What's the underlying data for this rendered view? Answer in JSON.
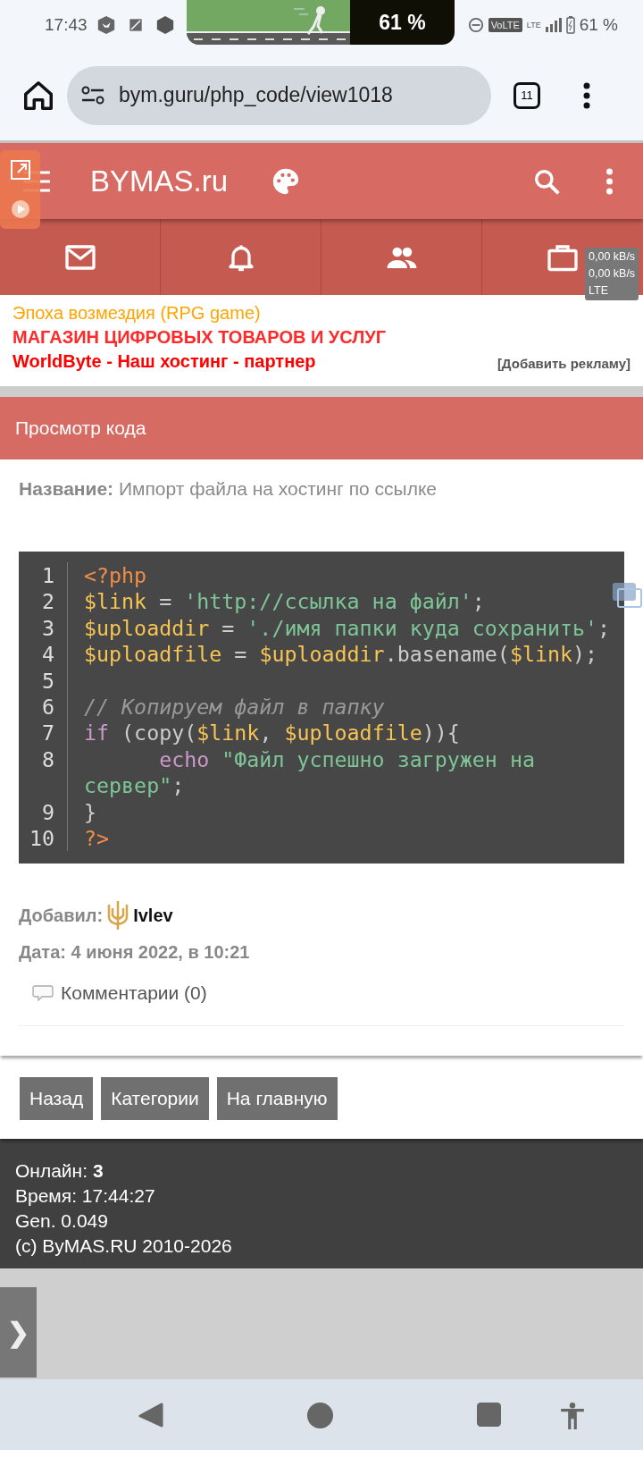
{
  "status_bar": {
    "time": "17:43",
    "media_pill": {
      "kind": "picture",
      "percent": "61 %"
    },
    "volte": "VoLTE",
    "network_type": "LTE",
    "battery": "61 %"
  },
  "browser": {
    "url": "bym.guru/php_code/view1018",
    "tab_count": "11"
  },
  "site_header": {
    "logo": "BYMAS.ru"
  },
  "speed_overlay": {
    "upload": "0,00 kB/s",
    "download": "0,00 kB/s",
    "network": "LTE"
  },
  "ads": [
    {
      "text": "Эпоха возмездия (RPG game)",
      "color": "#ffa500",
      "kind": "plain"
    },
    {
      "text": "МАГАЗИН ЦИФРОВЫХ ТОВАРОВ И УСЛУГ",
      "color": "#ff2a2a",
      "kind": "bold"
    },
    {
      "text": "WorldByte - Наш хостинг - партнер",
      "color": "#ff0000",
      "kind": "bold"
    }
  ],
  "add_ad": "[Добавить рекламу]",
  "section_title": "Просмотр кода",
  "name_line": "**Название:** Импорт файла на хостинг по ссылке",
  "code": {
    "lines": [
      {
        "number": "1",
        "tokens": [
          {
            "kind": "tag",
            "text": "<?php"
          }
        ]
      },
      {
        "number": "2",
        "tokens": [
          {
            "kind": "variable",
            "text": "$link"
          },
          {
            "kind": "plain",
            "text": " = "
          },
          {
            "kind": "string",
            "text": "'http://ссылка на файл'"
          },
          {
            "kind": "plain",
            "text": ";"
          }
        ]
      },
      {
        "number": "3",
        "tokens": [
          {
            "kind": "variable",
            "text": "$uploaddir"
          },
          {
            "kind": "plain",
            "text": " = "
          },
          {
            "kind": "string",
            "text": "'./имя папки куда сохранить'"
          },
          {
            "kind": "plain",
            "text": ";"
          }
        ]
      },
      {
        "number": "4",
        "tokens": [
          {
            "kind": "variable",
            "text": "$uploadfile"
          },
          {
            "kind": "plain",
            "text": " = "
          },
          {
            "kind": "variable",
            "text": "$uploaddir"
          },
          {
            "kind": "plain",
            "text": ".basename("
          },
          {
            "kind": "variable",
            "text": "$link"
          },
          {
            "kind": "plain",
            "text": ");"
          }
        ]
      },
      {
        "number": "5"
      },
      {
        "number": "6",
        "tokens": [
          {
            "kind": "comment",
            "text": "// Копируем файл в папку"
          }
        ]
      },
      {
        "number": "7",
        "tokens": [
          {
            "kind": "keyword",
            "text": "if"
          },
          {
            "kind": "plain",
            "text": " (copy("
          },
          {
            "kind": "variable",
            "text": "$link"
          },
          {
            "kind": "plain",
            "text": ", "
          },
          {
            "kind": "variable",
            "text": "$uploadfile"
          },
          {
            "kind": "plain",
            "text": ")){"
          }
        ]
      },
      {
        "number": "8",
        "tokens": [
          {
            "kind": "keyword",
            "text": "      echo "
          },
          {
            "kind": "string",
            "text": "\"Файл успешно загружен на сервер\""
          },
          {
            "kind": "plain",
            "text": ";"
          }
        ]
      },
      {
        "number": "9",
        "tokens": [
          {
            "kind": "plain",
            "text": "}"
          }
        ]
      },
      {
        "number": "10",
        "tokens": [
          {
            "kind": "tag",
            "text": "?>"
          }
        ]
      }
    ]
  },
  "meta": {
    "author_label": "Добавил:",
    "author": "Ivlev",
    "date": "Дата: 4 июня 2022, в 10:21",
    "comments": "Комментарии (0)"
  },
  "buttons": [
    "Назад",
    "Категории",
    "На главную"
  ],
  "footer": {
    "lines": [
      "Онлайн: **3**",
      "Время: 17:44:27",
      "Gen. 0.049",
      "(c) ByMAS.RU 2010-2026"
    ]
  },
  "side_tab": "❯"
}
